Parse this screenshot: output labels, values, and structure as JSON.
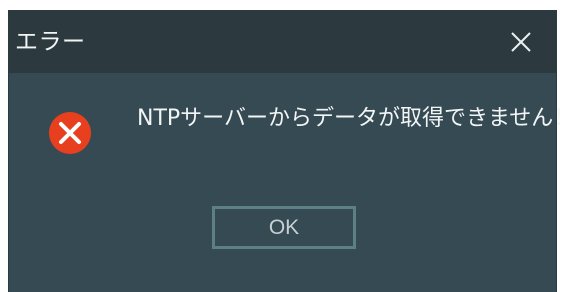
{
  "dialog": {
    "title": "エラー",
    "message": "NTPサーバーからデータが取得できません！",
    "ok_label": "OK",
    "close_icon": "close-icon",
    "error_icon": "error-icon",
    "colors": {
      "background": "#354a52",
      "titlebar": "#2c3a40",
      "text": "#f2f5f6",
      "error": "#e8401e",
      "button_border": "#5d8087",
      "button_text": "#c5d0d4"
    }
  }
}
